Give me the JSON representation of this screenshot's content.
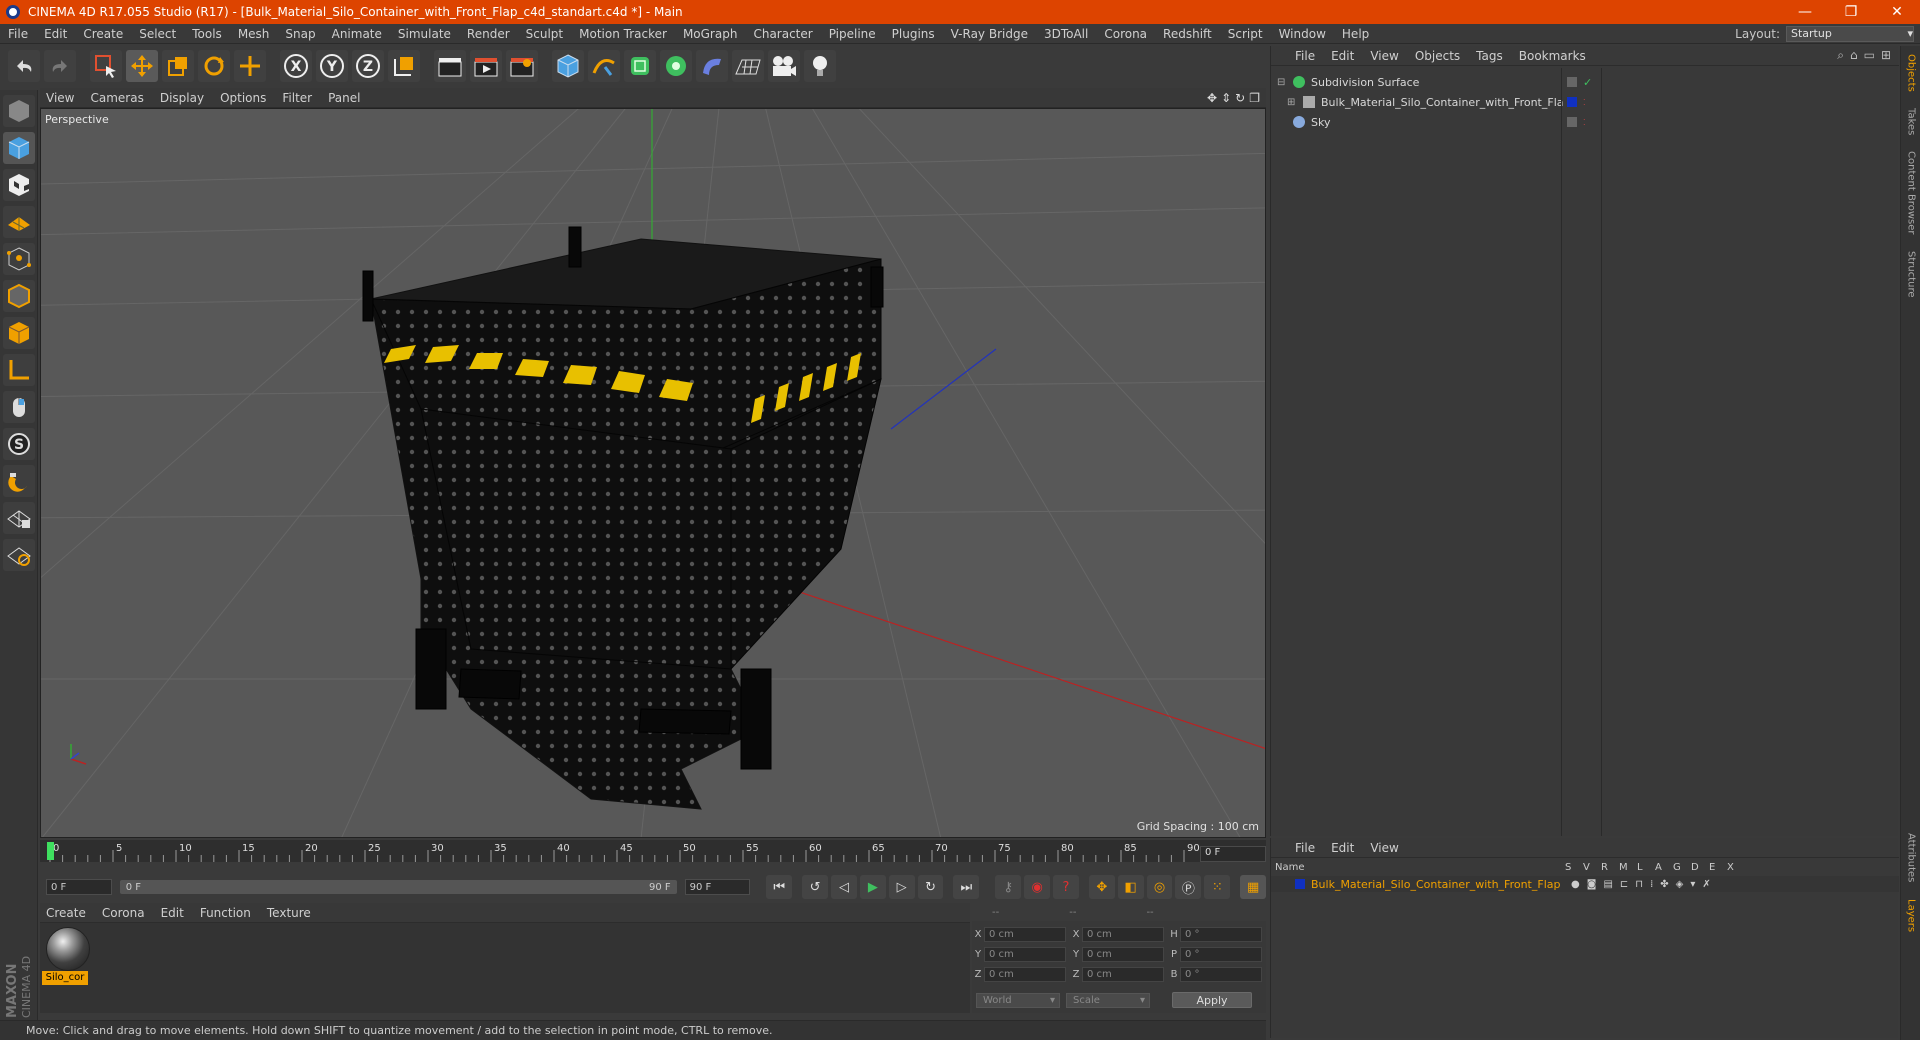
{
  "titlebar": {
    "title": "CINEMA 4D R17.055 Studio (R17) - [Bulk_Material_Silo_Container_with_Front_Flap_c4d_standart.c4d *] - Main",
    "minimize": "—",
    "maximize": "❐",
    "close": "✕"
  },
  "menubar": {
    "items": [
      "File",
      "Edit",
      "Create",
      "Select",
      "Tools",
      "Mesh",
      "Snap",
      "Animate",
      "Simulate",
      "Render",
      "Sculpt",
      "Motion Tracker",
      "MoGraph",
      "Character",
      "Pipeline",
      "Plugins",
      "V-Ray Bridge",
      "3DToAll",
      "Corona",
      "Redshift",
      "Script",
      "Window",
      "Help"
    ],
    "layout_label": "Layout:",
    "layout_value": "Startup"
  },
  "toolbar": {
    "axis_labels": [
      "X",
      "Y",
      "Z"
    ]
  },
  "viewport": {
    "menu": [
      "View",
      "Cameras",
      "Display",
      "Options",
      "Filter",
      "Panel"
    ],
    "camera_label": "Perspective",
    "grid_spacing": "Grid Spacing : 100 cm"
  },
  "timeline": {
    "ticks": [
      "0",
      "5",
      "10",
      "15",
      "20",
      "25",
      "30",
      "35",
      "40",
      "45",
      "50",
      "55",
      "60",
      "65",
      "70",
      "75",
      "80",
      "85",
      "90"
    ],
    "current_frame": "0 F"
  },
  "transport": {
    "start_field": "0 F",
    "range_start": "0 F",
    "range_end": "90 F",
    "end_field": "90 F"
  },
  "material_manager": {
    "menu": [
      "Create",
      "Corona",
      "Edit",
      "Function",
      "Texture"
    ],
    "materials": [
      {
        "name": "Silo_cor"
      }
    ]
  },
  "coordinates": {
    "header": [
      "--",
      "--",
      "--"
    ],
    "rows": [
      {
        "a1": "X",
        "v1": "0 cm",
        "a2": "X",
        "v2": "0 cm",
        "a3": "H",
        "v3": "0 °"
      },
      {
        "a1": "Y",
        "v1": "0 cm",
        "a2": "Y",
        "v2": "0 cm",
        "a3": "P",
        "v3": "0 °"
      },
      {
        "a1": "Z",
        "v1": "0 cm",
        "a2": "Z",
        "v2": "0 cm",
        "a3": "B",
        "v3": "0 °"
      }
    ],
    "world_dropdown": "World",
    "scale_dropdown": "Scale",
    "apply_label": "Apply"
  },
  "object_manager": {
    "menu": [
      "File",
      "Edit",
      "View",
      "Objects",
      "Tags",
      "Bookmarks"
    ],
    "objects": [
      {
        "name": "Subdivision Surface",
        "icon_color": "#3fbf5f"
      },
      {
        "name": "Bulk_Material_Silo_Container_with_Front_Flap",
        "icon_color": "#aaaaaa",
        "tag_color": "#1030c0"
      },
      {
        "name": "Sky",
        "icon_color": "#88aadd"
      }
    ]
  },
  "layer_manager": {
    "menu": [
      "File",
      "Edit",
      "View"
    ],
    "columns": [
      "Name",
      "S",
      "V",
      "R",
      "M",
      "L",
      "A",
      "G",
      "D",
      "E",
      "X"
    ],
    "layers": [
      {
        "name": "Bulk_Material_Silo_Container_with_Front_Flap",
        "color": "#1030c0"
      }
    ]
  },
  "right_tabs": [
    "Objects",
    "Takes",
    "Content Browser",
    "Structure",
    "Attributes",
    "Layers"
  ],
  "brand": {
    "line1": "MAXON",
    "line2": "CINEMA 4D"
  },
  "status": {
    "text": "Move: Click and drag to move elements. Hold down SHIFT to quantize movement / add to the selection in point mode, CTRL to remove."
  },
  "colors": {
    "title_bg": "#dd4400",
    "accent": "#f0a000",
    "x_axis": "#cc2222",
    "y_axis": "#22aa22",
    "z_axis": "#3344cc"
  }
}
